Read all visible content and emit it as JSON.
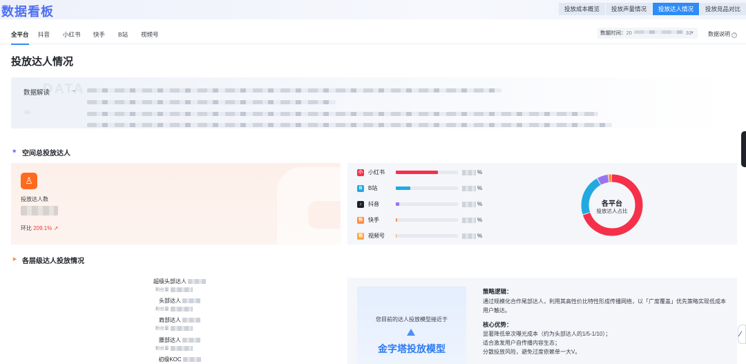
{
  "header": {
    "brand": "数据看板",
    "tabs": [
      {
        "label": "投放成本概览",
        "active": false
      },
      {
        "label": "投放声量情况",
        "active": false
      },
      {
        "label": "投放达人情况",
        "active": true
      },
      {
        "label": "投放竞品对比",
        "active": false
      }
    ]
  },
  "platform_tabs": [
    {
      "label": "全平台",
      "active": true
    },
    {
      "label": "抖音",
      "active": false
    },
    {
      "label": "小红书",
      "active": false
    },
    {
      "label": "快手",
      "active": false
    },
    {
      "label": "B站",
      "active": false
    },
    {
      "label": "视频号",
      "active": false
    }
  ],
  "date_filter": {
    "label": "数据时间：",
    "value_left": "20",
    "value_right": "31"
  },
  "explain_label": "数据说明",
  "page_title": "投放达人情况",
  "interpretation": {
    "label": "数据解读",
    "watermark": "DATA"
  },
  "section_space": {
    "title": "空间总投放达人"
  },
  "total": {
    "label": "投放达人数",
    "ratio_label": "环比",
    "ratio_value": "209.1%"
  },
  "platforms": [
    {
      "name": "小红书",
      "icon": "xiaohongshu-icon",
      "color": "#f5304a",
      "share": 0.68,
      "suffix": "%"
    },
    {
      "name": "B站",
      "icon": "bilibili-icon",
      "color": "#22aae0",
      "share": 0.23,
      "suffix": "%"
    },
    {
      "name": "抖音",
      "icon": "douyin-icon",
      "color": "#9a73f0",
      "share": 0.06,
      "suffix": "%"
    },
    {
      "name": "快手",
      "icon": "kuaishou-icon",
      "color": "#ff8a3c",
      "share": 0.02,
      "suffix": "%"
    },
    {
      "name": "视频号",
      "icon": "shipinhao-icon",
      "color": "#f7a83a",
      "share": 0.004,
      "suffix": "%"
    }
  ],
  "donut": {
    "title": "各平台",
    "subtitle": "投放达人占比",
    "segments": [
      {
        "share": 0.7,
        "color": "#f5304a"
      },
      {
        "share": 0.22,
        "color": "#22aae0"
      },
      {
        "share": 0.06,
        "color": "#9a73f0"
      },
      {
        "share": 0.02,
        "color": "#ff8a3c"
      }
    ]
  },
  "section_tiers": {
    "title": "各层级达人投放情况"
  },
  "tiers": [
    {
      "name": "超级头部达人",
      "sub": "粉丝量"
    },
    {
      "name": "头部达人",
      "sub": "粉丝量"
    },
    {
      "name": "肩部达人",
      "sub": "粉丝量"
    },
    {
      "name": "腰部达人",
      "sub": "粉丝量"
    },
    {
      "name": "初级KOC",
      "sub": ""
    }
  ],
  "model": {
    "note": "您目前的达人投放模型接近于",
    "name": "金字塔投放模型",
    "strategy_title": "策略逻辑：",
    "strategy_text": "通过规模化合作尾部达人，利用其高性价比特性形成传播网络，以「广度覆盖」优先策略实现低成本用户触达。",
    "advantage_title": "核心优势：",
    "advantages": [
      "显著降低单次曝光成本（约为头部达人的1/5-1/10）；",
      "适合激发用户自传播内容生态；",
      "分散投放风险，避免过度依赖单一大V。"
    ]
  }
}
